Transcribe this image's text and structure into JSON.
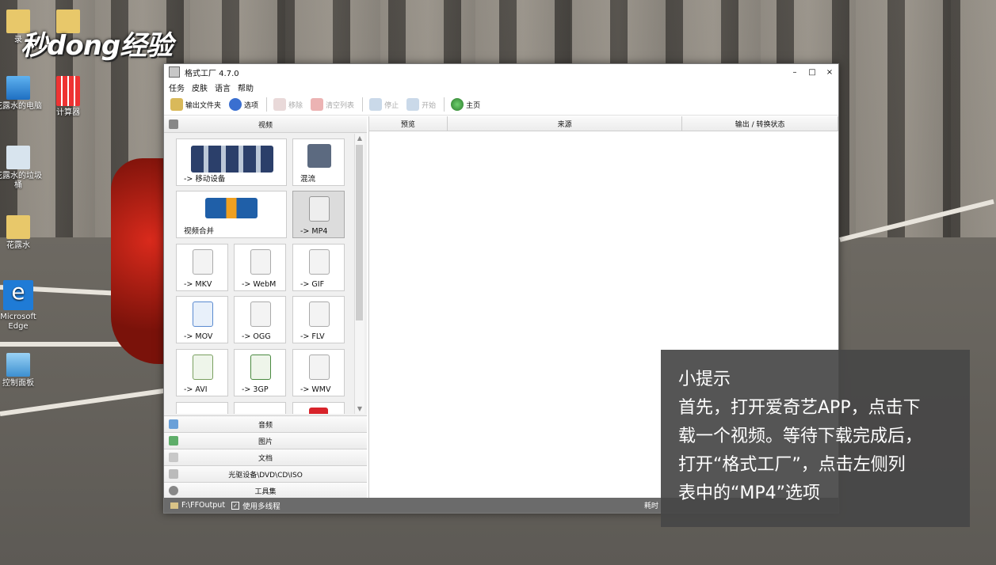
{
  "desktop": {
    "logo_text": "秒dong经验",
    "icons": [
      {
        "label": "录"
      },
      {
        "label": "花露水的电脑"
      },
      {
        "label": "计算器"
      },
      {
        "label": "花露水的垃圾桶"
      },
      {
        "label": "花露水"
      },
      {
        "label": "Microsoft Edge"
      },
      {
        "label": "控制面板"
      }
    ]
  },
  "window": {
    "title": "格式工厂 4.7.0",
    "controls": {
      "minimize": "–",
      "maximize": "□",
      "close": "×"
    },
    "menu": [
      "任务",
      "皮肤",
      "语言",
      "帮助"
    ],
    "toolbar": {
      "output_folder": "输出文件夹",
      "options": "选项",
      "remove": "移除",
      "clear_list": "清空列表",
      "stop": "停止",
      "start": "开始",
      "home": "主页"
    },
    "left_panel": {
      "video_header": "视频",
      "tiles": [
        {
          "label": "-> 移动设备"
        },
        {
          "label": "混流"
        },
        {
          "label": "视频合并"
        },
        {
          "label": "-> MP4"
        },
        {
          "label": "-> MKV"
        },
        {
          "label": "-> WebM"
        },
        {
          "label": "-> GIF"
        },
        {
          "label": "-> MOV"
        },
        {
          "label": "-> OGG"
        },
        {
          "label": "-> FLV"
        },
        {
          "label": "-> AVI"
        },
        {
          "label": "-> 3GP"
        },
        {
          "label": "-> WMV"
        }
      ],
      "categories": [
        "音频",
        "图片",
        "文档",
        "光驱设备\\DVD\\CD\\ISO",
        "工具集"
      ]
    },
    "table": {
      "columns": [
        "预览",
        "来源",
        "输出 / 转换状态"
      ]
    },
    "statusbar": {
      "output_path": "F:\\FFOutput",
      "multithread": "使用多线程",
      "elapsed_label": "耗时"
    }
  },
  "tip": {
    "title": "小提示",
    "lines": [
      "首先，打开爱奇艺APP，点击下",
      "载一个视频。等待下载完成后，",
      "打开“格式工厂”，点击左侧列",
      "表中的“MP4”选项"
    ]
  }
}
